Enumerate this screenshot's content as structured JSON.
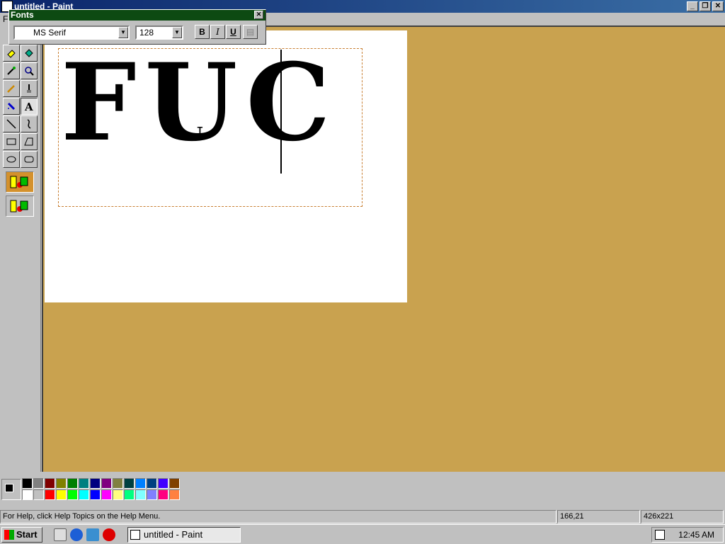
{
  "window": {
    "title": "untitled - Paint",
    "menu_first": "F"
  },
  "fonts_toolbar": {
    "title": "Fonts",
    "font_name": "MS Serif",
    "font_size": "128",
    "bold_label": "B",
    "italic_label": "I",
    "underline_label": "U"
  },
  "canvas": {
    "typed_text": "FUC"
  },
  "palette": {
    "colors_top": [
      "#000000",
      "#808080",
      "#800000",
      "#808000",
      "#008000",
      "#008080",
      "#000080",
      "#800080",
      "#808040",
      "#004040",
      "#0080ff",
      "#004080",
      "#4000ff",
      "#804000"
    ],
    "colors_bottom": [
      "#ffffff",
      "#c0c0c0",
      "#ff0000",
      "#ffff00",
      "#00ff00",
      "#00ffff",
      "#0000ff",
      "#ff00ff",
      "#ffff80",
      "#00ff80",
      "#80ffff",
      "#8080ff",
      "#ff0080",
      "#ff8040"
    ]
  },
  "status": {
    "help_text": "For Help, click Help Topics on the Help Menu.",
    "coords": "166,21",
    "size": "426x221"
  },
  "taskbar": {
    "start_label": "Start",
    "task_label": "untitled - Paint",
    "clock": "12:45 AM"
  }
}
